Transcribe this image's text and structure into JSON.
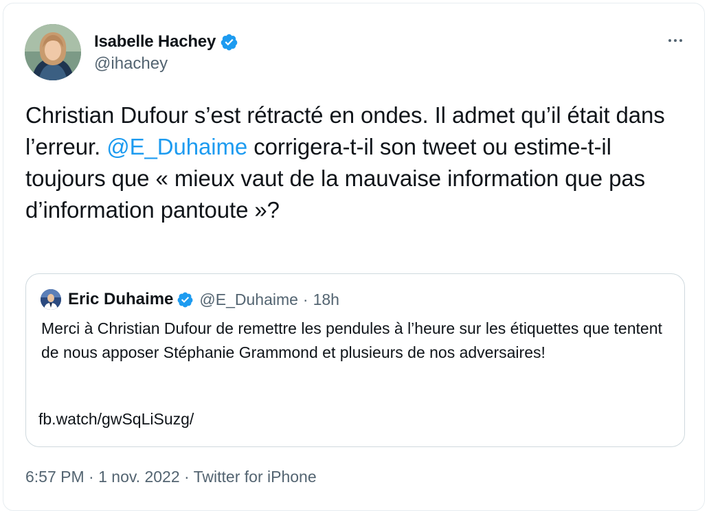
{
  "author": {
    "name": "Isabelle Hachey",
    "handle": "@ihachey",
    "verified": true
  },
  "tweet": {
    "text_before": "Christian Dufour s’est rétracté en ondes. Il admet qu’il était dans l’erreur. ",
    "mention": "@E_Duhaime",
    "text_after": " corrigera-t-il son tweet ou estime-t-il toujours que « mieux vaut de la mauvaise information que pas d’information pantoute »?"
  },
  "quoted_tweet": {
    "author_name": "Eric Duhaime",
    "handle": "@E_Duhaime",
    "separator": "·",
    "time": "18h",
    "text": "Merci à Christian Dufour de remettre les pendules à l’heure sur les étiquettes que tentent de nous apposer Stéphanie Grammond et plusieurs de nos adversaires!",
    "link": "fb.watch/gwSqLiSuzg/"
  },
  "footer": {
    "time": "6:57 PM",
    "separator": " · ",
    "date": "1 nov. 2022",
    "source": "Twitter for iPhone"
  },
  "colors": {
    "text": "#0f1419",
    "secondary": "#536471",
    "accent": "#1d9bf0",
    "border": "#cfd9de"
  },
  "icons": {
    "verified": "verified-badge-icon",
    "more": "more-options-icon"
  }
}
